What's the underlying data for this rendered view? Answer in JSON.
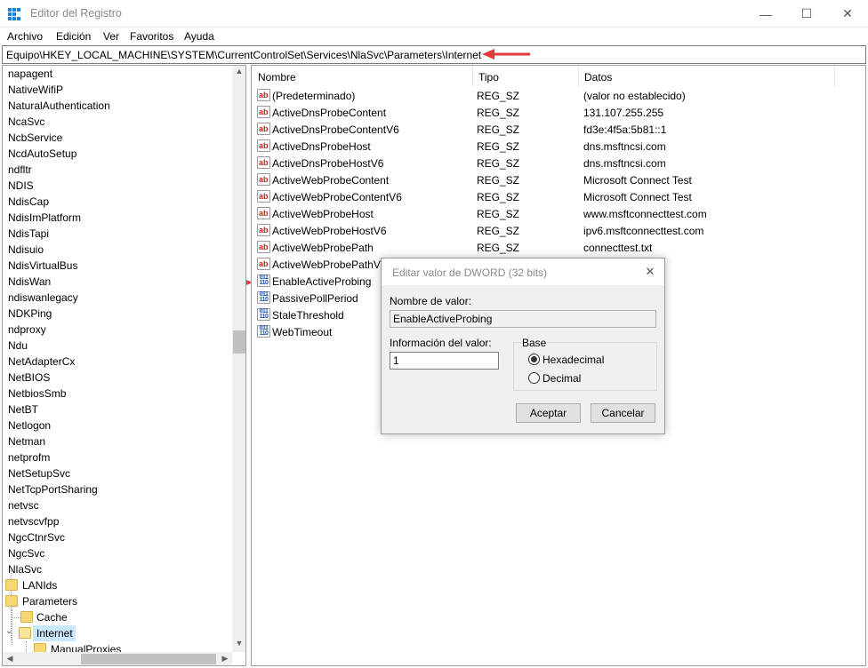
{
  "window": {
    "title": "Editor del Registro",
    "minimize_glyph": "—",
    "maximize_glyph": "☐",
    "close_glyph": "✕"
  },
  "menu": [
    "Archivo",
    "Edición",
    "Ver",
    "Favoritos",
    "Ayuda"
  ],
  "address": "Equipo\\HKEY_LOCAL_MACHINE\\SYSTEM\\CurrentControlSet\\Services\\NlaSvc\\Parameters\\Internet",
  "tree": {
    "items": [
      "napagent",
      "NativeWifiP",
      "NaturalAuthentication",
      "NcaSvc",
      "NcbService",
      "NcdAutoSetup",
      "ndfltr",
      "NDIS",
      "NdisCap",
      "NdisImPlatform",
      "NdisTapi",
      "Ndisuio",
      "NdisVirtualBus",
      "NdisWan",
      "ndiswanlegacy",
      "NDKPing",
      "ndproxy",
      "Ndu",
      "NetAdapterCx",
      "NetBIOS",
      "NetbiosSmb",
      "NetBT",
      "Netlogon",
      "Netman",
      "netprofm",
      "NetSetupSvc",
      "NetTcpPortSharing",
      "netvsc",
      "netvscvfpp",
      "NgcCtnrSvc",
      "NgcSvc",
      "NlaSvc"
    ],
    "sub_lanids": "LANIds",
    "sub_parameters": "Parameters",
    "sub_cache": "Cache",
    "sub_internet": "Internet",
    "sub_manualproxies": "ManualProxies"
  },
  "list": {
    "headers": {
      "name": "Nombre",
      "type": "Tipo",
      "data": "Datos"
    },
    "rows": [
      {
        "icon": "string-value-icon",
        "name": "(Predeterminado)",
        "type": "REG_SZ",
        "data": "(valor no establecido)"
      },
      {
        "icon": "string-value-icon",
        "name": "ActiveDnsProbeContent",
        "type": "REG_SZ",
        "data": "131.107.255.255"
      },
      {
        "icon": "string-value-icon",
        "name": "ActiveDnsProbeContentV6",
        "type": "REG_SZ",
        "data": "fd3e:4f5a:5b81::1"
      },
      {
        "icon": "string-value-icon",
        "name": "ActiveDnsProbeHost",
        "type": "REG_SZ",
        "data": "dns.msftncsi.com"
      },
      {
        "icon": "string-value-icon",
        "name": "ActiveDnsProbeHostV6",
        "type": "REG_SZ",
        "data": "dns.msftncsi.com"
      },
      {
        "icon": "string-value-icon",
        "name": "ActiveWebProbeContent",
        "type": "REG_SZ",
        "data": "Microsoft Connect Test"
      },
      {
        "icon": "string-value-icon",
        "name": "ActiveWebProbeContentV6",
        "type": "REG_SZ",
        "data": "Microsoft Connect Test"
      },
      {
        "icon": "string-value-icon",
        "name": "ActiveWebProbeHost",
        "type": "REG_SZ",
        "data": "www.msftconnecttest.com"
      },
      {
        "icon": "string-value-icon",
        "name": "ActiveWebProbeHostV6",
        "type": "REG_SZ",
        "data": "ipv6.msftconnecttest.com"
      },
      {
        "icon": "string-value-icon",
        "name": "ActiveWebProbePath",
        "type": "REG_SZ",
        "data": "connecttest.txt"
      },
      {
        "icon": "string-value-icon",
        "name": "ActiveWebProbePathV6",
        "type": "",
        "data": ""
      },
      {
        "icon": "dword-value-icon",
        "name": "EnableActiveProbing",
        "type": "",
        "data": ""
      },
      {
        "icon": "dword-value-icon",
        "name": "PassivePollPeriod",
        "type": "",
        "data": ""
      },
      {
        "icon": "dword-value-icon",
        "name": "StaleThreshold",
        "type": "",
        "data": ""
      },
      {
        "icon": "dword-value-icon",
        "name": "WebTimeout",
        "type": "",
        "data": ""
      }
    ]
  },
  "dialog": {
    "title": "Editar valor de DWORD (32 bits)",
    "close_glyph": "✕",
    "value_name_label": "Nombre de valor:",
    "value_name": "EnableActiveProbing",
    "value_data_label": "Información del valor:",
    "value_data": "1",
    "base_label": "Base",
    "hex_label": "Hexadecimal",
    "dec_label": "Decimal",
    "selected_base": "Hexadecimal",
    "ok_label": "Aceptar",
    "cancel_label": "Cancelar"
  },
  "colors": {
    "annotation_arrow": "#e0393e",
    "selection": "#cce8ff",
    "folder": "#f8d775"
  },
  "icons": {
    "sz_glyph": "ab",
    "dword_glyph": "011\n110"
  }
}
